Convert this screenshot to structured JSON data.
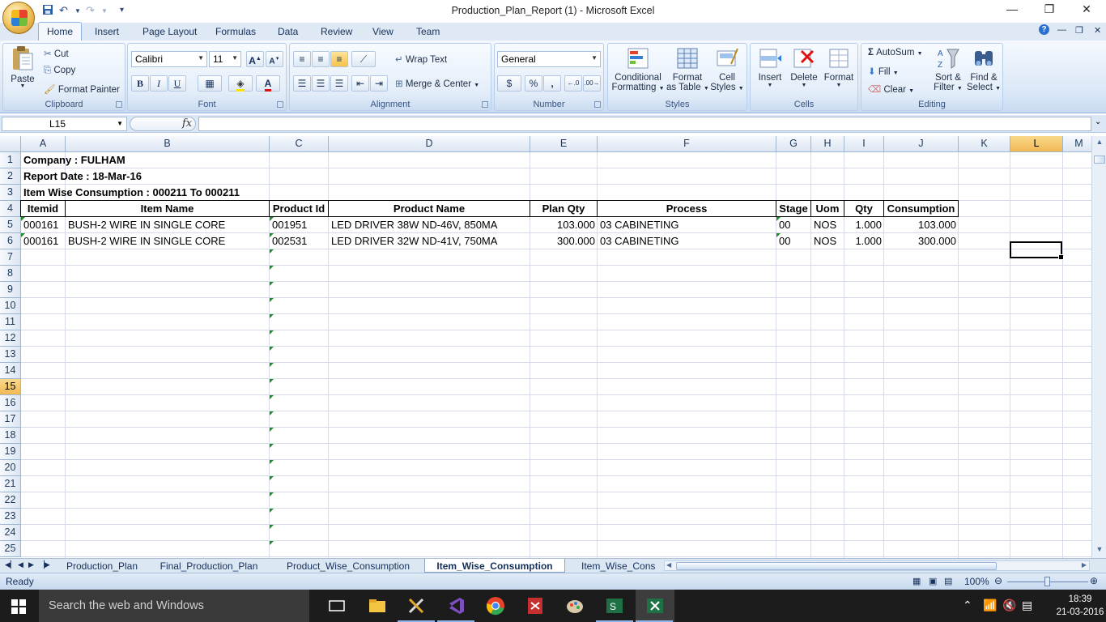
{
  "window": {
    "title": "Production_Plan_Report (1) - Microsoft Excel",
    "controls": {
      "minimize": "—",
      "restore": "❐",
      "close": "✕"
    }
  },
  "ribbon_tabs": [
    "Home",
    "Insert",
    "Page Layout",
    "Formulas",
    "Data",
    "Review",
    "View",
    "Team"
  ],
  "active_tab": "Home",
  "ribbon": {
    "clipboard": {
      "label": "Clipboard",
      "paste": "Paste",
      "cut": "Cut",
      "copy": "Copy",
      "format_painter": "Format Painter"
    },
    "font": {
      "label": "Font",
      "name": "Calibri",
      "size": "11",
      "bold": "B",
      "italic": "I",
      "underline": "U"
    },
    "alignment": {
      "label": "Alignment",
      "wrap_text": "Wrap Text",
      "merge_center": "Merge & Center"
    },
    "number": {
      "label": "Number",
      "format": "General",
      "percent": "%",
      "comma": ","
    },
    "styles": {
      "label": "Styles",
      "conditional": [
        "Conditional",
        "Formatting"
      ],
      "format_table": [
        "Format",
        "as Table"
      ],
      "cell_styles": [
        "Cell",
        "Styles"
      ]
    },
    "cells": {
      "label": "Cells",
      "insert": "Insert",
      "delete": "Delete",
      "format": "Format"
    },
    "editing": {
      "label": "Editing",
      "autosum": "AutoSum",
      "fill": "Fill",
      "clear": "Clear",
      "sort_filter": [
        "Sort &",
        "Filter"
      ],
      "find_select": [
        "Find &",
        "Select"
      ]
    }
  },
  "formula_bar": {
    "name_box": "L15",
    "fx": "fx",
    "formula": ""
  },
  "columns": [
    "A",
    "B",
    "C",
    "D",
    "E",
    "F",
    "G",
    "H",
    "I",
    "J",
    "K",
    "L",
    "M"
  ],
  "rows": [
    "1",
    "2",
    "3",
    "4",
    "5",
    "6",
    "7",
    "8",
    "9",
    "10",
    "11",
    "12",
    "13",
    "14",
    "15",
    "16",
    "17",
    "18",
    "19",
    "20",
    "21",
    "22",
    "23",
    "24",
    "25"
  ],
  "selected_cell": {
    "column": "L",
    "row": "15"
  },
  "sheet": {
    "company": "Company : FULHAM",
    "report_date": "Report Date : 18-Mar-16",
    "range": "Item Wise Consumption : 000211 To 000211",
    "headers": [
      "Itemid",
      "Item Name",
      "Product Id",
      "Product Name",
      "Plan Qty",
      "Process",
      "Stage",
      "Uom",
      "Qty",
      "Consumption"
    ],
    "data": [
      [
        "000161",
        "BUSH-2 WIRE IN SINGLE CORE",
        "001951",
        "LED DRIVER 38W ND-46V, 850MA",
        "103.000",
        "03 CABINETING",
        "00",
        "NOS",
        "1.000",
        "103.000"
      ],
      [
        "000161",
        "BUSH-2 WIRE IN SINGLE CORE",
        "002531",
        "LED DRIVER 32W ND-41V, 750MA",
        "300.000",
        "03 CABINETING",
        "00",
        "NOS",
        "1.000",
        "300.000"
      ]
    ]
  },
  "sheet_tabs": [
    "Production_Plan",
    "Final_Production_Plan",
    "Product_Wise_Consumption",
    "Item_Wise_Consumption",
    "Item_Wise_Cons"
  ],
  "active_sheet": "Item_Wise_Consumption",
  "status": {
    "ready": "Ready",
    "zoom": "100%"
  },
  "taskbar": {
    "search": "Search the web and Windows",
    "time": "18:39",
    "date": "21-03-2016"
  },
  "colors": {
    "ribbon": "#dbe8f7",
    "accent": "#15305a",
    "selected_header": "#f2b954",
    "taskbar": "#1c1c1c"
  }
}
